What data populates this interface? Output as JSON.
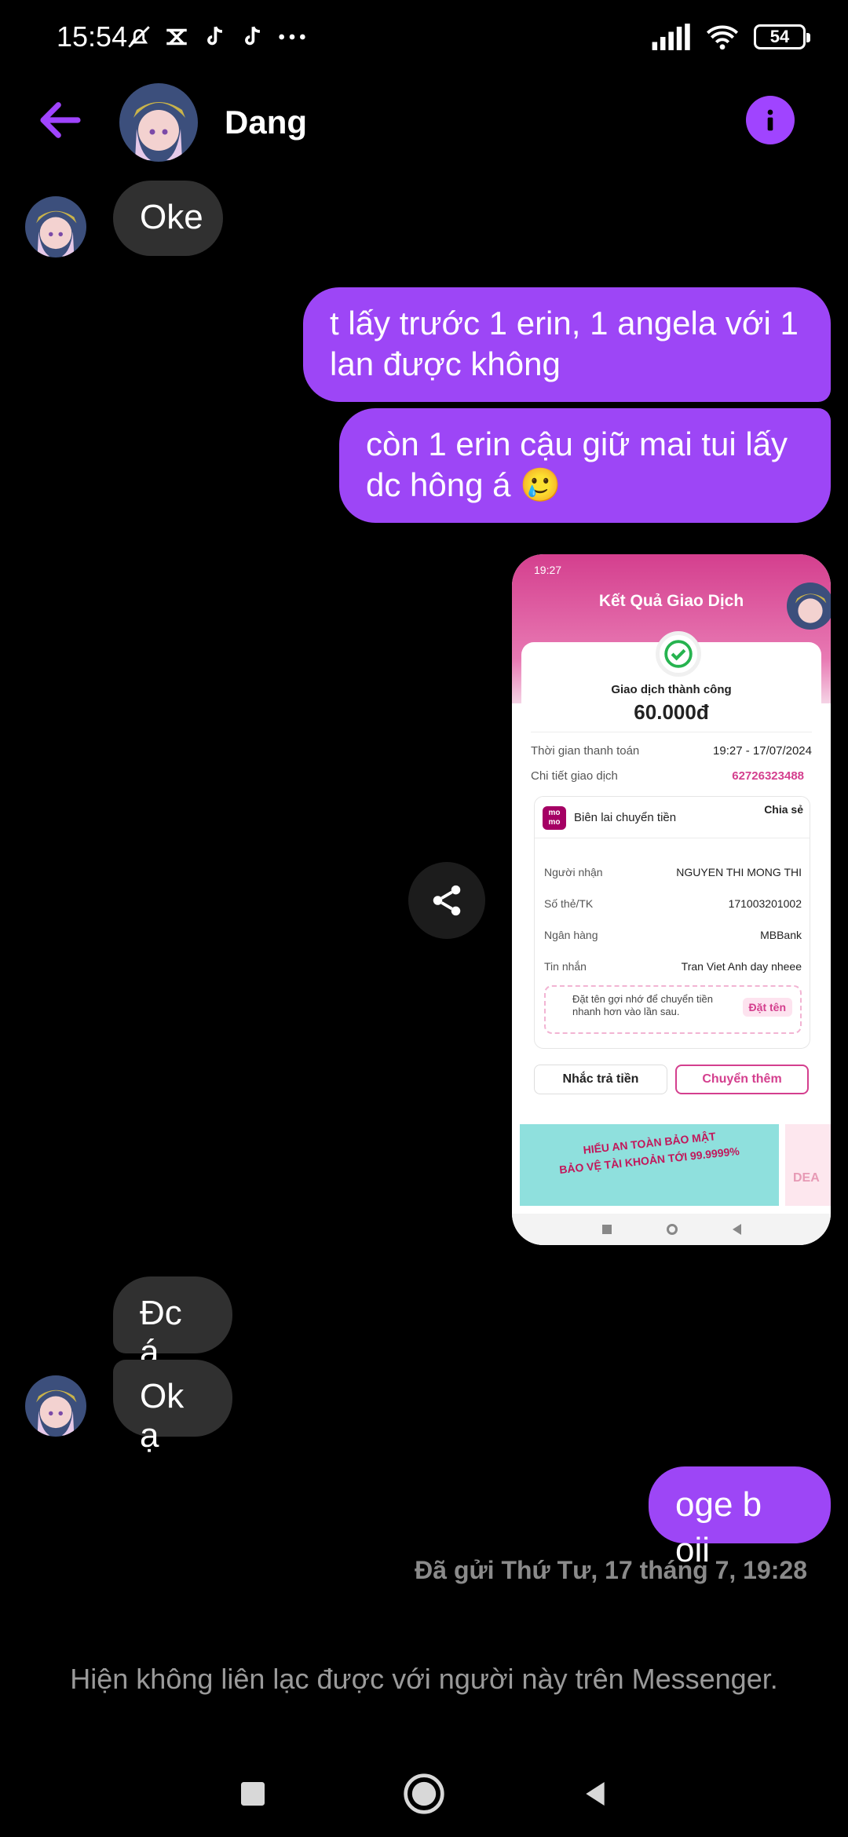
{
  "status_bar": {
    "time": "15:54",
    "battery": "54"
  },
  "header": {
    "contact_name": "Dang"
  },
  "messages": {
    "m1": "Oke",
    "m2": "t lấy trước 1 erin, 1 angela với 1 lan được không",
    "m3": "còn 1 erin cậu giữ mai tui lấy dc hông á 🥲",
    "m4": "Đc á",
    "m5": "Ok ạ",
    "m6": "oge b oii"
  },
  "shared_image": {
    "time": "19:27",
    "title": "Kết Quả Giao Dịch",
    "status": "Giao dịch thành công",
    "amount": "60.000đ",
    "time_label": "Thời gian thanh toán",
    "time_value": "19:27 - 17/07/2024",
    "detail_label": "Chi tiết giao dịch",
    "detail_value": "62726323488",
    "receipt_label": "Biên lai chuyển tiền",
    "share_label": "Chia sẻ",
    "logo_text": "mo mo",
    "receiver_label": "Người nhận",
    "receiver_value": "NGUYEN THI MONG THI",
    "account_label": "Số thẻ/TK",
    "account_value": "171003201002",
    "bank_label": "Ngân hàng",
    "bank_value": "MBBank",
    "note_label": "Tin nhắn",
    "note_value": "Tran Viet Anh day nheee",
    "nickname_hint": "Đặt tên gợi nhớ để chuyển tiền nhanh hơn vào lần sau.",
    "nickname_button": "Đặt tên",
    "remind_button": "Nhắc trả tiền",
    "transfer_more_button": "Chuyển thêm",
    "banner_line1": "HIỂU AN TOÀN BẢO MẬT",
    "banner_line2": "BẢO VỆ TÀI KHOẢN TỚI 99.9999%",
    "side_banner": "DEA"
  },
  "footer": {
    "sent_label": "Đã gửi Thứ Tư, 17 tháng 7, 19:28",
    "unavailable": "Hiện không liên lạc được với người này trên Messenger."
  },
  "colors": {
    "accent": "#9d46f6",
    "incoming": "#303030",
    "background": "#000000"
  },
  "icons": [
    "back-arrow-icon",
    "info-icon",
    "share-icon",
    "battery-icon",
    "wifi-icon",
    "signal-icon"
  ]
}
